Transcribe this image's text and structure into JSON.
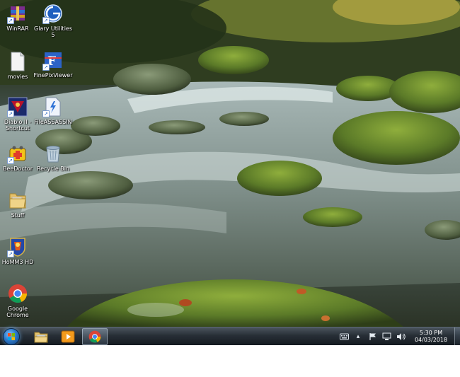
{
  "desktop": {
    "icons": [
      {
        "label": "WinRAR",
        "icon": "winrar-icon",
        "shortcut": true
      },
      {
        "label": "Glary Utilities 5",
        "icon": "glary-utilities-icon",
        "shortcut": true
      },
      {
        "label": "movies",
        "icon": "file-icon",
        "shortcut": false
      },
      {
        "label": "FinePixViewer",
        "icon": "finepix-viewer-icon",
        "shortcut": true
      },
      {
        "label": "Diablo II - Shortcut",
        "icon": "diablo-icon",
        "shortcut": true
      },
      {
        "label": "FileASSASSIN",
        "icon": "fileassassin-icon",
        "shortcut": true
      },
      {
        "label": "BeeDoctor",
        "icon": "beedoctor-icon",
        "shortcut": true
      },
      {
        "label": "Recycle Bin",
        "icon": "recycle-bin-icon",
        "shortcut": false
      },
      {
        "label": "Stuff",
        "icon": "folder-icon",
        "shortcut": false
      },
      {
        "label": "HoMM3 HD",
        "icon": "homm3-icon",
        "shortcut": true
      },
      {
        "label": "Google Chrome",
        "icon": "chrome-icon",
        "shortcut": false
      }
    ]
  },
  "taskbar": {
    "pinned": [
      {
        "name": "file-explorer",
        "icon": "folder-icon"
      },
      {
        "name": "media-player",
        "icon": "media-player-icon"
      },
      {
        "name": "google-chrome",
        "icon": "chrome-icon",
        "active": true
      }
    ],
    "tray": {
      "icons": [
        "keyboard-icon",
        "chevron-up-icon",
        "flag-icon",
        "network-icon",
        "volume-icon"
      ],
      "time": "5:30 PM",
      "date": "04/03/2018"
    }
  },
  "colors": {
    "taskbar": "#1c242c",
    "start_orb": "#2e79c9",
    "chrome_red": "#db4437",
    "chrome_green": "#0f9d58",
    "chrome_yellow": "#f4b400",
    "chrome_blue": "#4285f4"
  }
}
